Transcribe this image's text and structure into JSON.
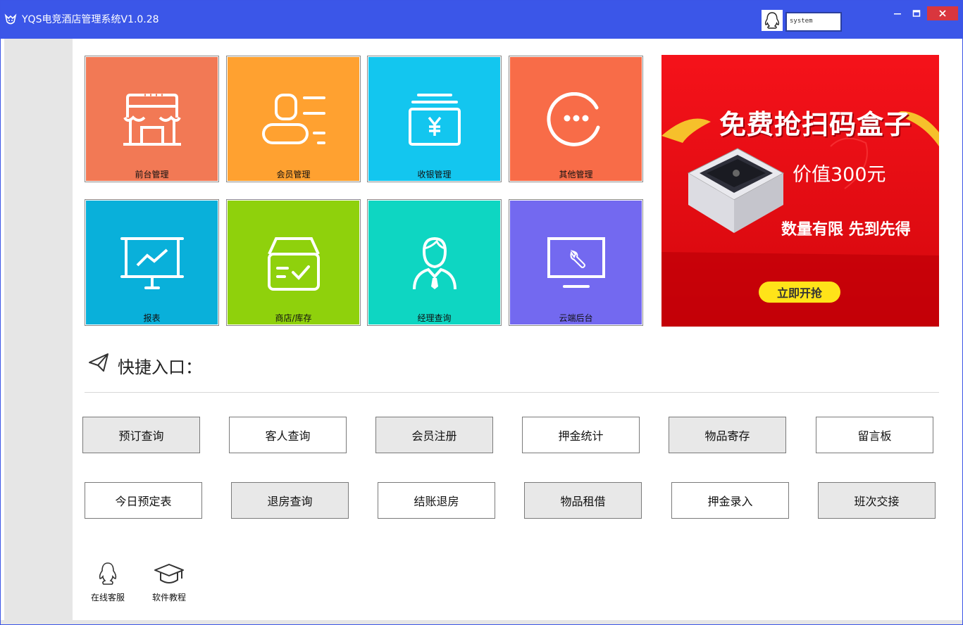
{
  "window": {
    "title": "YQS电竞酒店管理系统V1.0.28",
    "user": "system"
  },
  "tiles": [
    {
      "label": "前台管理",
      "color": "#f27955",
      "icon": "storefront-icon"
    },
    {
      "label": "会员管理",
      "color": "#ffa130",
      "icon": "member-card-icon"
    },
    {
      "label": "收银管理",
      "color": "#13c6ef",
      "icon": "cashier-yen-icon"
    },
    {
      "label": "其他管理",
      "color": "#f86c48",
      "icon": "more-dots-icon"
    },
    {
      "label": "报表",
      "color": "#09b0da",
      "icon": "report-chart-icon"
    },
    {
      "label": "商店/库存",
      "color": "#8fd10c",
      "icon": "inventory-box-icon"
    },
    {
      "label": "经理查询",
      "color": "#0ed6c2",
      "icon": "manager-icon"
    },
    {
      "label": "云端后台",
      "color": "#7369f0",
      "icon": "cloud-admin-monitor-icon"
    }
  ],
  "banner": {
    "title": "免费抢扫码盒子",
    "price": "价值300元",
    "limit": "数量有限  先到先得",
    "button": "立即开抢"
  },
  "quick": {
    "title": "快捷入口：",
    "row1": [
      "预订查询",
      "客人查询",
      "会员注册",
      "押金统计",
      "物品寄存",
      "留言板"
    ],
    "row2": [
      "今日预定表",
      "退房查询",
      "结账退房",
      "物品租借",
      "押金录入",
      "班次交接"
    ]
  },
  "bottom": {
    "service": "在线客服",
    "tutorial": "软件教程"
  }
}
